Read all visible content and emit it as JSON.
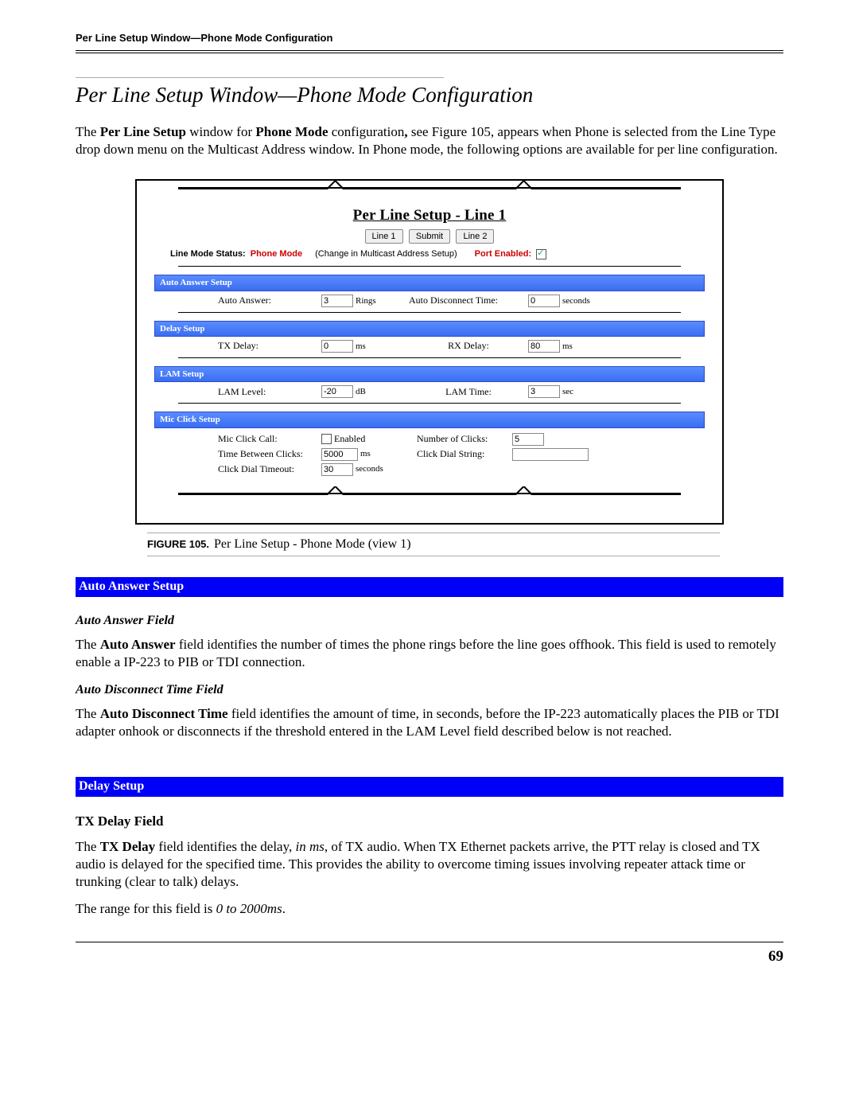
{
  "head": {
    "running": "Per Line Setup Window—Phone Mode Configuration",
    "title": "Per Line Setup Window—Phone Mode Configuration"
  },
  "intro": {
    "pre1": "The ",
    "b1": "Per Line Setup",
    "mid1": " window for ",
    "b2": "Phone Mode",
    "mid2": " configuration",
    "comma": ",",
    "post": " see Figure 105, appears when Phone is selected from the Line Type drop down menu on the Multicast Address window. In Phone mode, the following options are available for per line configuration."
  },
  "figure": {
    "caption_label": "FIGURE 105.",
    "caption_text": "Per Line Setup - Phone Mode (view 1)",
    "panel_title": "Per Line Setup - Line 1",
    "btn_line1": "Line 1",
    "btn_submit": "Submit",
    "btn_line2": "Line 2",
    "lms_label": "Line Mode Status:",
    "lms_value": "Phone Mode",
    "lms_note": "(Change in Multicast Address Setup)",
    "port_enabled_label": "Port Enabled:",
    "sections": {
      "aas": "Auto Answer Setup",
      "ds": "Delay Setup",
      "ls": "LAM Setup",
      "mcs": "Mic Click Setup"
    },
    "aas": {
      "auto_answer_label": "Auto Answer:",
      "auto_answer_val": "3",
      "auto_answer_unit": "Rings",
      "adt_label": "Auto Disconnect Time:",
      "adt_val": "0",
      "adt_unit": "seconds"
    },
    "ds": {
      "tx_label": "TX Delay:",
      "tx_val": "0",
      "tx_unit": "ms",
      "rx_label": "RX Delay:",
      "rx_val": "80",
      "rx_unit": "ms"
    },
    "ls": {
      "ll_label": "LAM Level:",
      "ll_val": "-20",
      "ll_unit": "dB",
      "lt_label": "LAM Time:",
      "lt_val": "3",
      "lt_unit": "sec"
    },
    "mcs": {
      "mcc_label": "Mic Click Call:",
      "mcc_enabled": "Enabled",
      "noc_label": "Number of Clicks:",
      "noc_val": "5",
      "tbc_label": "Time Between Clicks:",
      "tbc_val": "5000",
      "tbc_unit": "ms",
      "cds_label": "Click Dial String:",
      "cdt_label": "Click Dial Timeout:",
      "cdt_val": "30",
      "cdt_unit": "seconds"
    }
  },
  "aas_section": {
    "bar": "Auto Answer Setup",
    "aaf_head": "Auto Answer Field",
    "aaf_p_pre": "The ",
    "aaf_p_b": "Auto Answer",
    "aaf_p_post": " field identifies the number of times the phone rings before the line goes offhook. This field is used to remotely enable a IP-223 to PIB or TDI connection.",
    "adt_head": "Auto Disconnect Time Field",
    "adt_p_pre": "The ",
    "adt_p_b": "Auto Disconnect Time",
    "adt_p_post": " field identifies the amount of time, in seconds, before the IP-223 automatically places the PIB or TDI adapter onhook or disconnects if the threshold entered in the LAM Level field described below is not reached."
  },
  "ds_section": {
    "bar": "Delay Setup",
    "tx_head": "TX Delay Field",
    "tx_p_pre": "The ",
    "tx_p_b": "TX Delay",
    "tx_p_mid": " field identifies the delay, ",
    "tx_p_i": "in ms",
    "tx_p_post": ", of TX audio. When TX Ethernet packets arrive, the PTT relay is closed and TX audio is delayed for the specified time. This provides the ability to overcome timing issues involving repeater attack time or trunking (clear to talk) delays.",
    "tx_range_pre": "The range for this field is ",
    "tx_range_i": "0 to 2000ms",
    "tx_range_post": "."
  },
  "page_number": "69"
}
